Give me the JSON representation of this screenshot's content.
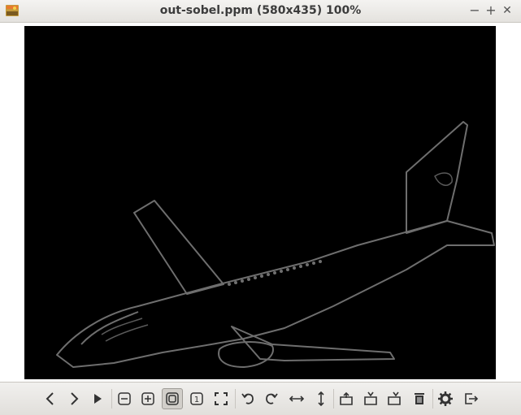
{
  "window": {
    "title": "out-sobel.ppm (580x435) 100%",
    "minimize_glyph": "−",
    "maximize_glyph": "+",
    "close_glyph": "✕"
  },
  "image": {
    "description_icon": "edge-detected-airplane-image"
  },
  "toolbar": {
    "buttons": [
      {
        "name": "previous-icon"
      },
      {
        "name": "next-icon"
      },
      {
        "name": "slideshow-play-icon"
      },
      {
        "name": "zoom-out-icon"
      },
      {
        "name": "zoom-in-icon"
      },
      {
        "name": "zoom-fit-icon",
        "active": true
      },
      {
        "name": "zoom-original-icon",
        "label": "1"
      },
      {
        "name": "fullscreen-icon"
      },
      {
        "name": "rotate-left-icon"
      },
      {
        "name": "rotate-right-icon"
      },
      {
        "name": "flip-horizontal-icon"
      },
      {
        "name": "flip-vertical-icon"
      },
      {
        "name": "open-icon"
      },
      {
        "name": "save-icon"
      },
      {
        "name": "save-as-icon"
      },
      {
        "name": "delete-icon"
      },
      {
        "name": "settings-gear-icon"
      },
      {
        "name": "exit-icon"
      }
    ]
  }
}
